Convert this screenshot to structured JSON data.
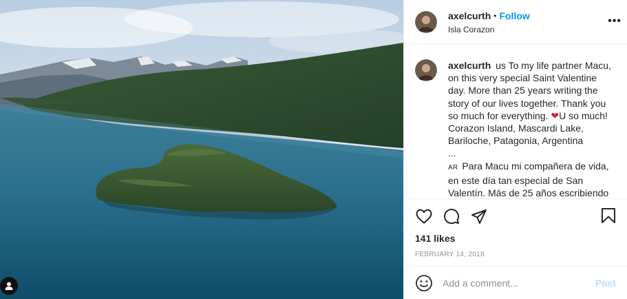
{
  "post": {
    "username": "axelcurth",
    "separator": "•",
    "follow_label": "Follow",
    "location": "Isla Corazon",
    "more_label": "•••",
    "caption_text": "us To my life partner Macu, on this very special Saint Valentine day. More than 25 years writing the story of our lives together. Thank you so much for everything.",
    "heart_emoji": "❤",
    "caption_text_2": "U so much! Corazon Island, Mascardi Lake, Bariloche, Patagonia, Argentina",
    "ellipsis": "...",
    "ar_label": "AR",
    "caption_spanish": "Para Macu mi compañera de vida, en este día tan especial de San Valentín. Más de 25 años escribiendo",
    "likes": "141 likes",
    "date": "FEBRUARY 14, 2018",
    "comment_placeholder": "Add a comment...",
    "post_label": "Post"
  },
  "icons": {
    "like": "heart-outline-icon",
    "comment": "speech-bubble-icon",
    "share": "paper-plane-icon",
    "save": "bookmark-icon",
    "emoji": "smiley-icon",
    "tag": "user-tag-icon"
  },
  "colors": {
    "follow": "#0095f6",
    "post_disabled": "#b2dffc",
    "heart": "#d8232a"
  }
}
